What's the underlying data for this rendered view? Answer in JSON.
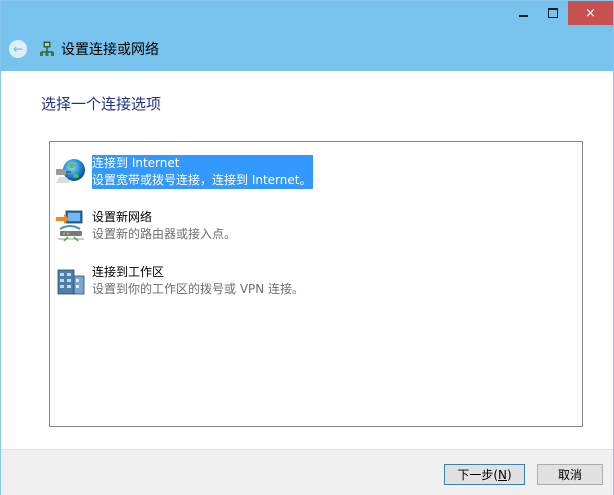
{
  "window": {
    "title": "设置连接或网络",
    "controls": {
      "minimize": "minimize",
      "maximize": "maximize",
      "close": "×"
    },
    "back_glyph": "←"
  },
  "page": {
    "heading": "选择一个连接选项"
  },
  "options": [
    {
      "title": "连接到 Internet",
      "description": "设置宽带或拨号连接，连接到 Internet。",
      "icon": "globe-network-icon",
      "selected": true
    },
    {
      "title": "设置新网络",
      "description": "设置新的路由器或接入点。",
      "icon": "router-setup-icon",
      "selected": false
    },
    {
      "title": "连接到工作区",
      "description": "设置到你的工作区的拨号或 VPN 连接。",
      "icon": "workplace-building-icon",
      "selected": false
    }
  ],
  "footer": {
    "next_label": "下一步(",
    "next_accel": "N",
    "next_suffix": ")",
    "cancel_label": "取消"
  },
  "colors": {
    "titlebar": "#78c2ee",
    "close_button": "#c75050",
    "heading": "#1e3287",
    "selection": "#3399ff"
  }
}
